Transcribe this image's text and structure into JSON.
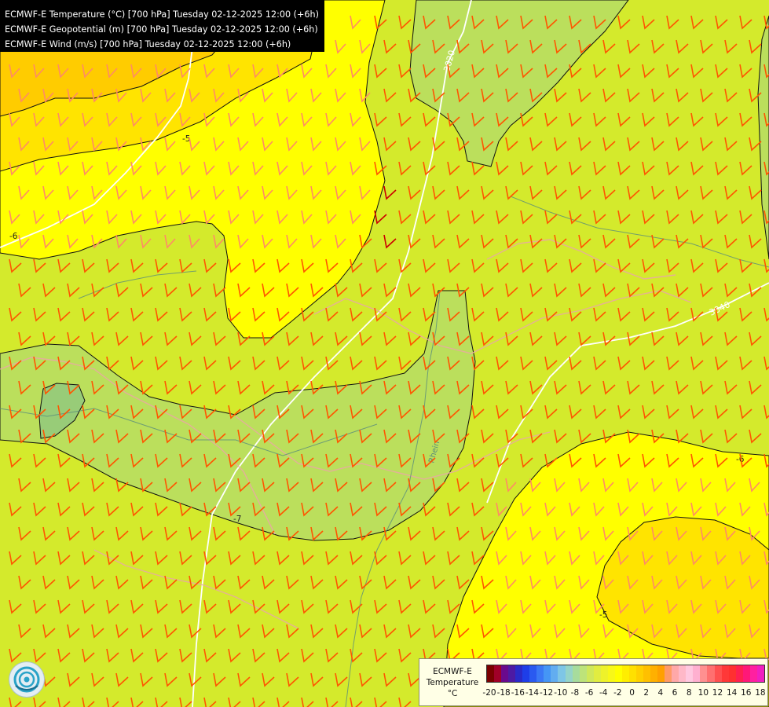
{
  "header": {
    "lines": [
      "ECMWF-E Temperature (°C) [700 hPa] Tuesday 02-12-2025 12:00 (+6h)",
      "ECMWF-E Geopotential (m) [700 hPa] Tuesday 02-12-2025 12:00 (+6h)",
      "ECMWF-E Wind (m/s) [700 hPa] Tuesday 02-12-2025 12:00 (+6h)"
    ]
  },
  "map": {
    "isotherm_labels": [
      "-5",
      "-6",
      "-7",
      "-6",
      "-5"
    ],
    "geopotential_labels": [
      "3020",
      "3040"
    ],
    "river_label": "Rhein",
    "colors": {
      "background": "#d4ea2c",
      "warm": "#ffff00",
      "warmer": "#ffe400",
      "warmest": "#ffcc00",
      "cold": "#bbdf5c",
      "colder": "#98cc78",
      "wind_barb": "#ff5500",
      "wind_barb_strong": "#cc0000",
      "geopotential_line": "#ffffff",
      "borders": "#e9aaa2",
      "rivers": "#5a8c7c"
    }
  },
  "legend": {
    "title_lines": [
      "ECMWF-E",
      "Temperature",
      "°C"
    ],
    "colors": [
      "#7a0000",
      "#a00028",
      "#6a0a8c",
      "#4d1aa3",
      "#2a2ac8",
      "#1e3ee8",
      "#2a5af0",
      "#3a78f5",
      "#4596f5",
      "#62adf0",
      "#7ec6e6",
      "#95d4c8",
      "#a7dc9c",
      "#bde37a",
      "#d0e85a",
      "#e1ed40",
      "#eef22a",
      "#f8f818",
      "#ffff00",
      "#ffee00",
      "#ffe000",
      "#ffd000",
      "#ffc000",
      "#ffb000",
      "#ffa000",
      "#ff9a66",
      "#ffa8a8",
      "#ffb8c8",
      "#ffc8e0",
      "#ffb0d0",
      "#ff9090",
      "#ff7070",
      "#ff5050",
      "#ff3838",
      "#ff3030",
      "#ff2050",
      "#ff1878",
      "#ff20a0",
      "#f020c0"
    ],
    "tick_labels": [
      "-20",
      "-18",
      "-16",
      "-14",
      "-12",
      "-10",
      "-8",
      "-6",
      "-4",
      "-2",
      "0",
      "2",
      "4",
      "6",
      "8",
      "10",
      "12",
      "14",
      "16",
      "18"
    ]
  }
}
